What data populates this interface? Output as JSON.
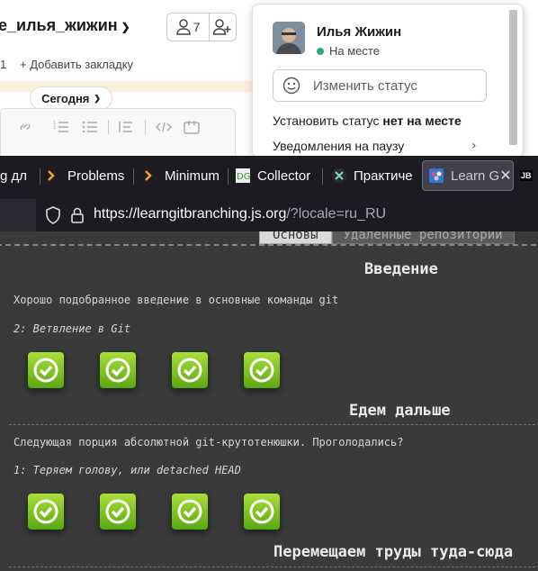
{
  "slack": {
    "channel_name": "e_илья_жижин",
    "member_count": "7",
    "bookmark_count": "1",
    "add_bookmark": "Добавить закладку",
    "date_pill": "Сегодня"
  },
  "status_popup": {
    "user_name": "Илья Жижин",
    "presence": "На месте",
    "change_status": "Изменить статус",
    "set_status_prefix": "Установить статус ",
    "set_status_bold": "нет на месте",
    "pause_notifications": "Уведомления на паузу"
  },
  "browser": {
    "tabs": [
      {
        "label": "g дл"
      },
      {
        "label": "Problems"
      },
      {
        "label": "Minimum"
      },
      {
        "label": "Collector"
      },
      {
        "label": "Практиче"
      },
      {
        "label": "Learn G"
      },
      {
        "label": "JB"
      }
    ],
    "url_main": "https://learngitbranching.js.org",
    "url_rest": "/?locale=ru_RU"
  },
  "lgb": {
    "tab_main": "Основы",
    "tab_remote": "Удалённые репозитории",
    "sections": [
      {
        "title": "Введение",
        "description": "Хорошо подобранное введение в основные команды git",
        "level": "2: Ветвление в Git",
        "completed_count": 4
      },
      {
        "title": "Едем дальше",
        "description": "Следующая порция абсолютной git-крутотенюшки. Проголодались?",
        "level": "1: Теряем голову, или detached HEAD",
        "completed_count": 4
      },
      {
        "title": "Перемещаем труды туда-сюда"
      }
    ]
  }
}
